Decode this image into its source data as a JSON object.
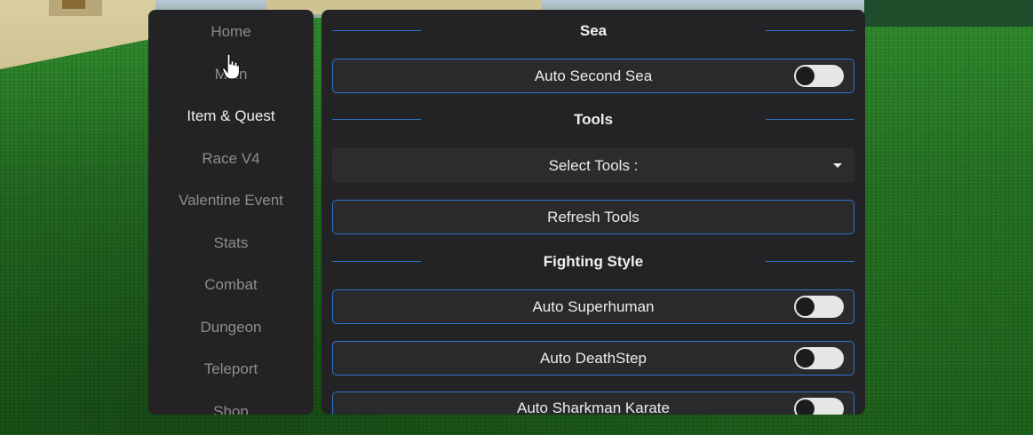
{
  "sidebar": {
    "items": [
      {
        "label": "Home"
      },
      {
        "label": "Main"
      },
      {
        "label": "Item & Quest"
      },
      {
        "label": "Race V4"
      },
      {
        "label": "Valentine Event"
      },
      {
        "label": "Stats"
      },
      {
        "label": "Combat"
      },
      {
        "label": "Dungeon"
      },
      {
        "label": "Teleport"
      },
      {
        "label": "Shop"
      }
    ],
    "active_item": "Item & Quest"
  },
  "panel": {
    "sea": {
      "title": "Sea",
      "auto_second_sea": {
        "label": "Auto Second Sea",
        "enabled": false
      }
    },
    "tools": {
      "title": "Tools",
      "select": {
        "label": "Select Tools :"
      },
      "refresh_label": "Refresh Tools"
    },
    "fighting_style": {
      "title": "Fighting Style",
      "auto_superhuman": {
        "label": "Auto Superhuman",
        "enabled": false
      },
      "auto_deathstep": {
        "label": "Auto DeathStep",
        "enabled": false
      },
      "auto_sharkman": {
        "label": "Auto Sharkman Karate",
        "enabled": false
      }
    }
  },
  "colors": {
    "panel_bg": "#232325",
    "accent": "#2f73c9",
    "active_text": "#f0f0f0",
    "inactive_text": "#8d8d8f"
  },
  "cursor": "hand-pointer-icon"
}
